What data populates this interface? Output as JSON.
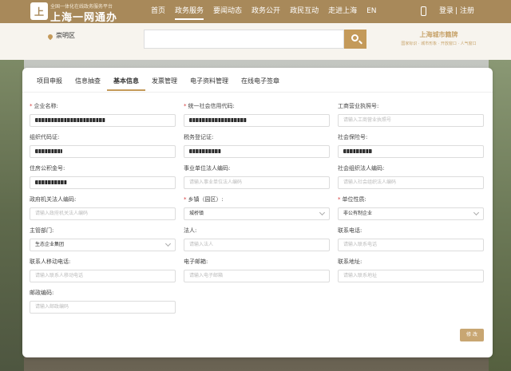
{
  "header": {
    "logo_glyph": "上",
    "logo_subtitle": "全国一体化在线政务服务平台",
    "logo_title": "上海一网通办",
    "nav": [
      {
        "label": "首页",
        "active": false
      },
      {
        "label": "政务服务",
        "active": true
      },
      {
        "label": "要闻动态",
        "active": false
      },
      {
        "label": "政务公开",
        "active": false
      },
      {
        "label": "政民互动",
        "active": false
      },
      {
        "label": "走进上海",
        "active": false
      },
      {
        "label": "EN",
        "active": false
      }
    ],
    "login": "登录",
    "separator": "|",
    "register": "注册"
  },
  "searchbar": {
    "location": "崇明区",
    "query": "",
    "placeholder": "",
    "brand_title": "上海城市籍牌",
    "brand_subtitle": "国家标识 · 城市形象 · 开放窗口 · 人气窗口"
  },
  "tabs": [
    {
      "label": "项目申报",
      "active": false
    },
    {
      "label": "信息抽查",
      "active": false
    },
    {
      "label": "基本信息",
      "active": true
    },
    {
      "label": "发票管理",
      "active": false
    },
    {
      "label": "电子资料管理",
      "active": false
    },
    {
      "label": "在线电子签章",
      "active": false
    }
  ],
  "form": {
    "company_name": {
      "label": "企业名称:",
      "required": true
    },
    "credit_code": {
      "label": "统一社会信用代码:",
      "required": true
    },
    "business_license": {
      "label": "工商营业执照号:",
      "required": false,
      "placeholder": "请输入工商营业执照号"
    },
    "org_code": {
      "label": "组织代码证:",
      "required": false
    },
    "tax_reg": {
      "label": "税务登记证:",
      "required": false
    },
    "social_insurance": {
      "label": "社会保险号:",
      "required": false
    },
    "housing_fund": {
      "label": "住房公积金号:",
      "required": false
    },
    "public_inst_code": {
      "label": "事业单位法人编码:",
      "required": false,
      "placeholder": "请输入事业单位法人编码"
    },
    "social_org_code": {
      "label": "社会组织法人编码:",
      "required": false,
      "placeholder": "请输入社会组织法人编码"
    },
    "gov_agency_code": {
      "label": "政府机关法人编码:",
      "required": false,
      "placeholder": "请输入政府机关法人编码"
    },
    "township": {
      "label": "乡镇（园区）:",
      "required": true,
      "value": "城桥镇"
    },
    "unit_nature": {
      "label": "单位性质:",
      "required": true,
      "value": "非公有制企业"
    },
    "authority": {
      "label": "主管部门:",
      "required": false,
      "value": "生态企业集团"
    },
    "legal_person": {
      "label": "法人:",
      "required": false,
      "placeholder": "请输入法人"
    },
    "contact_phone": {
      "label": "联系电话:",
      "required": false,
      "placeholder": "请输入联系电话"
    },
    "contact_mobile": {
      "label": "联系人移动电话:",
      "required": false,
      "placeholder": "请输入联系人移动电话"
    },
    "email": {
      "label": "电子邮箱:",
      "required": false,
      "placeholder": "请输入电子邮箱"
    },
    "address": {
      "label": "联系地址:",
      "required": false,
      "placeholder": "请输入联系地址"
    },
    "postcode": {
      "label": "邮政编码:",
      "required": false,
      "placeholder": "请输入邮政编码"
    }
  },
  "modify_button": "修 改",
  "colors": {
    "brand": "#a8895a",
    "accent": "#c49a5a",
    "required": "#d43b3b"
  }
}
